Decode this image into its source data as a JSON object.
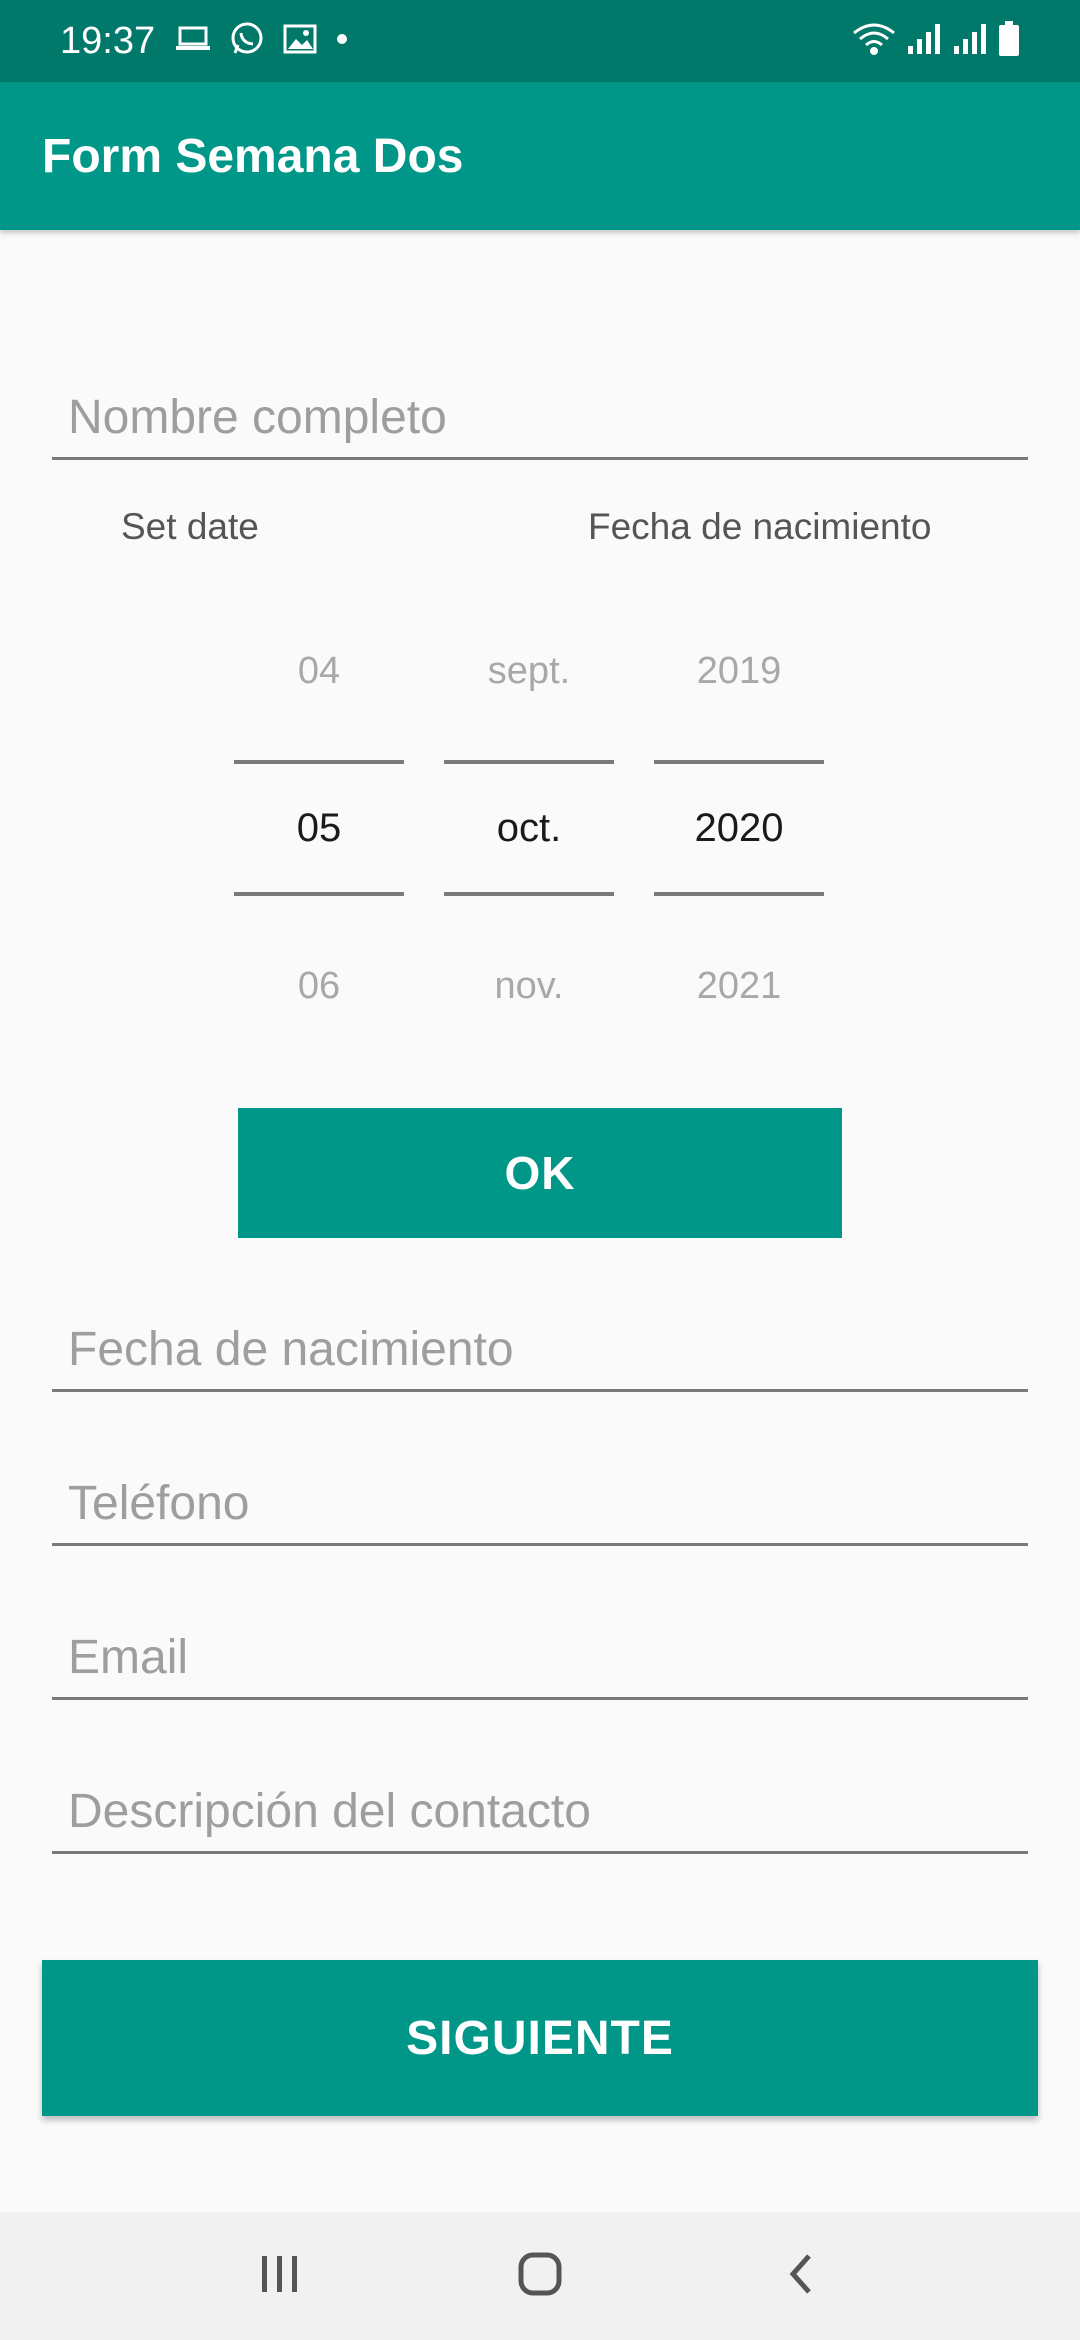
{
  "status_bar": {
    "time": "19:37",
    "left_icons": [
      "laptop-icon",
      "whatsapp-icon",
      "image-icon",
      "dot-icon"
    ],
    "right_icons": [
      "wifi-icon",
      "signal-icon",
      "signal-icon",
      "battery-icon"
    ]
  },
  "app_bar": {
    "title": "Form Semana Dos"
  },
  "form": {
    "nombre": {
      "placeholder": "Nombre completo",
      "value": ""
    },
    "set_date_label": "Set date",
    "fecha_label": "Fecha de nacimiento",
    "date_picker": {
      "day": {
        "prev": "04",
        "current": "05",
        "next": "06"
      },
      "month": {
        "prev": "sept.",
        "current": "oct.",
        "next": "nov."
      },
      "year": {
        "prev": "2019",
        "current": "2020",
        "next": "2021"
      }
    },
    "ok_label": "OK",
    "fecha_field": {
      "placeholder": "Fecha de nacimiento",
      "value": ""
    },
    "telefono": {
      "placeholder": "Teléfono",
      "value": ""
    },
    "email": {
      "placeholder": "Email",
      "value": ""
    },
    "descripcion": {
      "placeholder": "Descripción del contacto",
      "value": ""
    },
    "siguiente_label": "SIGUIENTE"
  },
  "colors": {
    "primary": "#009688",
    "primary_dark": "#00796b",
    "background": "#fafafa"
  },
  "nav_bar": {
    "icons": [
      "recents-icon",
      "home-icon",
      "back-icon"
    ]
  }
}
